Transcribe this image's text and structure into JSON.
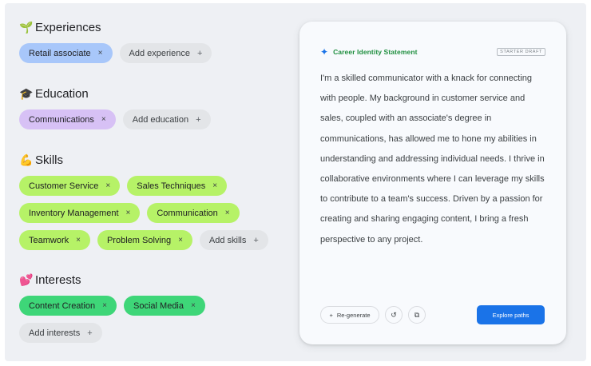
{
  "experiences": {
    "emoji": "🌱",
    "title": "Experiences",
    "chips": [
      {
        "label": "Retail associate"
      }
    ],
    "add_label": "Add experience"
  },
  "education": {
    "emoji": "🎓",
    "title": "Education",
    "chips": [
      {
        "label": "Communications"
      }
    ],
    "add_label": "Add education"
  },
  "skills": {
    "emoji": "💪",
    "title": "Skills",
    "chips": [
      {
        "label": "Customer Service"
      },
      {
        "label": "Sales Techniques"
      },
      {
        "label": "Inventory Management"
      },
      {
        "label": "Communication"
      },
      {
        "label": "Teamwork"
      },
      {
        "label": "Problem Solving"
      }
    ],
    "add_label": "Add skills"
  },
  "interests": {
    "emoji": "💕",
    "title": "Interests",
    "chips": [
      {
        "label": "Content Creation"
      },
      {
        "label": "Social Media"
      }
    ],
    "add_label": "Add interests"
  },
  "icons": {
    "remove": "×",
    "add": "+",
    "sparkle": "✦",
    "history": "↺",
    "copy": "⧉"
  },
  "card": {
    "title": "Career Identity Statement",
    "badge": "STARTER DRAFT",
    "statement": "I'm a skilled communicator with a knack for connecting with people. My background in customer service and sales, coupled with an associate's degree in communications, has allowed me to hone my abilities in understanding and addressing individual needs. I thrive in collaborative environments where I can leverage my skills to contribute to a team's success. Driven by a passion for creating and sharing engaging content, I bring a fresh perspective to any project.",
    "regenerate_label": "Re-generate",
    "explore_label": "Explore paths"
  },
  "colors": {
    "experience_chip": "#a8c7fa",
    "education_chip": "#d7c1f5",
    "skill_chip": "#b6f267",
    "interest_chip": "#3ed678",
    "add_chip": "#e3e5e8",
    "primary_button": "#1a73e8",
    "title_accent": "#1e8e3e"
  }
}
